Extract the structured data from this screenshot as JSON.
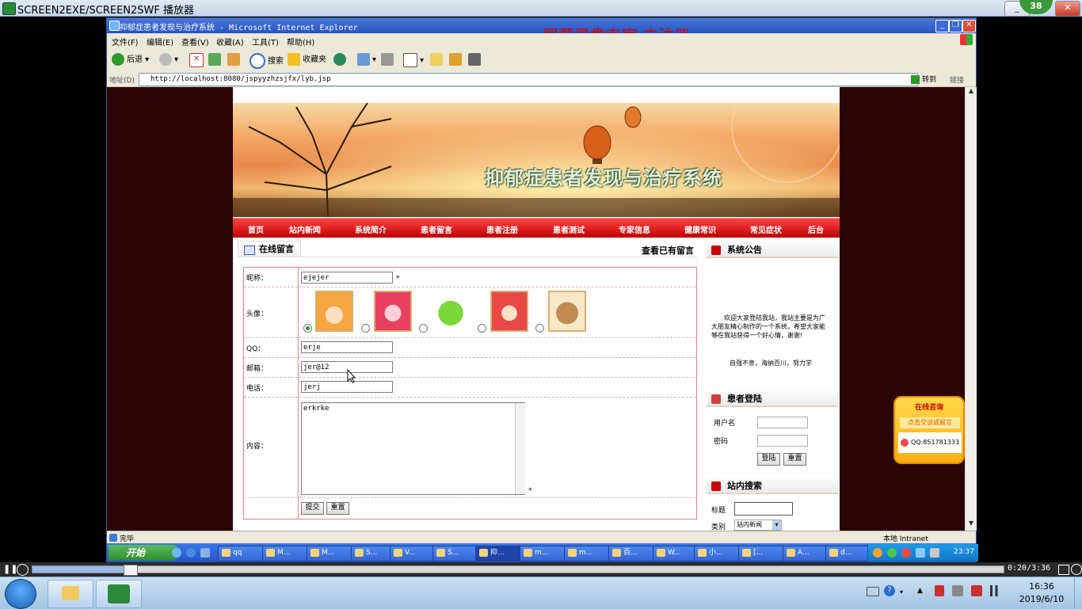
{
  "player": {
    "title": "SCREEN2EXE/SCREEN2SWF 播放器",
    "badge": "38",
    "timecode": "0:20/3:36",
    "progress_fraction": 0.1
  },
  "ie": {
    "title": "抑郁症患者发现与治疗系统 - Microsoft Internet Explorer",
    "watermark": "屏幕录像专家  未注册",
    "menu": [
      "文件(F)",
      "编辑(E)",
      "查看(V)",
      "收藏(A)",
      "工具(T)",
      "帮助(H)"
    ],
    "toolbar": {
      "back": "后退",
      "search": "搜索",
      "favorites": "收藏夹"
    },
    "address_label": "地址(D)",
    "url": "http://localhost:8080/jspyyzhzsjfx/lyb.jsp",
    "go": "转到",
    "links": "链接",
    "status": "完毕",
    "zone": "本地 Intranet"
  },
  "xp_taskbar": {
    "start": "开始",
    "tasks": [
      "qq",
      "M...",
      "M...",
      "S...",
      "V...",
      "S...",
      "抑...",
      "m...",
      "m...",
      "百...",
      "W...",
      "小...",
      "[...",
      "A...",
      "d..."
    ],
    "tray_time": "23:37"
  },
  "site": {
    "banner_title": "抑郁症患者发现与治疗系统",
    "nav": [
      "首页",
      "站内新闻",
      "系统简介",
      "患者留言",
      "患者注册",
      "患者测试",
      "专家信息",
      "健康常识",
      "常见症状",
      "后台"
    ]
  },
  "message": {
    "tab": "在线留言",
    "view_link": "查看已有留言",
    "labels": {
      "nickname": "昵称：",
      "avatar": "头像：",
      "qq": "QQ：",
      "email": "邮箱：",
      "phone": "电话：",
      "content": "内容："
    },
    "values": {
      "nickname": "ejejer",
      "qq": "erje",
      "email": "jer@12",
      "phone": "jerj",
      "content": "erkrke"
    },
    "required_mark": "*",
    "submit": "提交",
    "reset": "重置"
  },
  "sidebar": {
    "notice_title": "系统公告",
    "notice_text": "欢迎大家登陆我站，我站主要是为广大朋友精心制作的一个系统，希望大家能够在我站获得一个好心情，谢谢!",
    "motto": "自强不息，海纳百川，努力学",
    "login_title": "患者登陆",
    "username_label": "用户名",
    "password_label": "密码",
    "login_btn": "登陆",
    "reset_btn": "重置",
    "search_title": "站内搜索",
    "search_label": "标题",
    "category_label": "类别",
    "category_value": "站内新闻"
  },
  "consult": {
    "title": "在线咨询",
    "subtitle": "点击交谈或留言",
    "qq": "QQ:851781333"
  },
  "win7": {
    "time": "16:36",
    "date": "2019/6/10"
  }
}
